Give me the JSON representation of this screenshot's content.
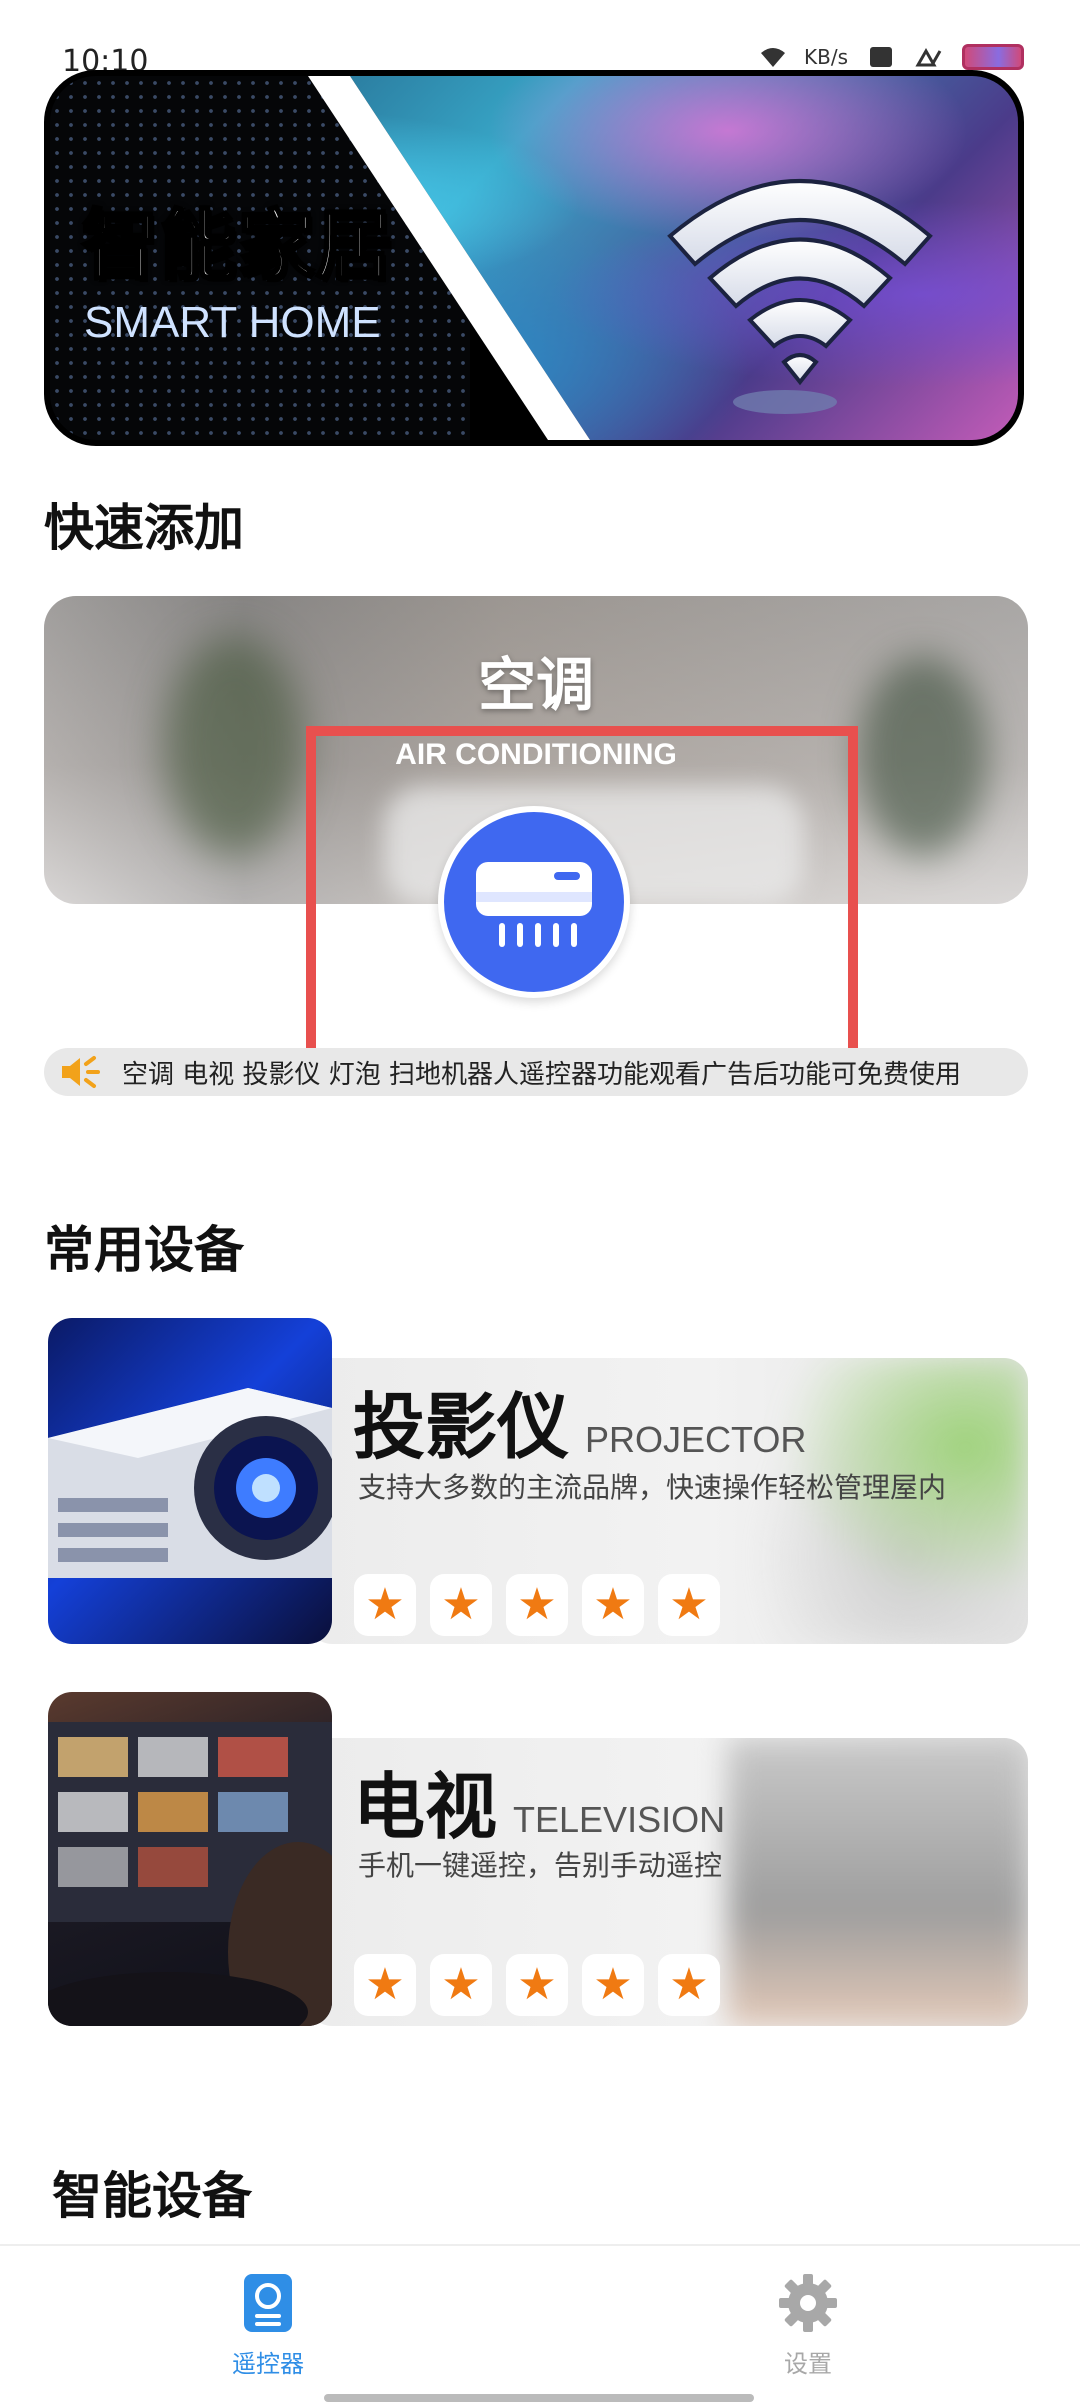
{
  "status_bar": {
    "time": "10:10",
    "speed": "KB/s"
  },
  "hero": {
    "title_cn": "智能家居",
    "title_en": "SMART HOME"
  },
  "quick_add": {
    "section_title": "快速添加",
    "card": {
      "title_cn": "空调",
      "title_en": "AIR CONDITIONING",
      "icon": "air-conditioner-icon"
    }
  },
  "notice": {
    "icon": "speaker-icon",
    "text": "空调 电视 投影仪 灯泡 扫地机器人遥控器功能观看广告后功能可免费使用"
  },
  "common_devices": {
    "section_title": "常用设备",
    "items": [
      {
        "title_cn": "投影仪",
        "title_en": "PROJECTOR",
        "description": "支持大多数的主流品牌，快速操作轻松管理屋内",
        "rating": 5,
        "star_icon": "star-icon"
      },
      {
        "title_cn": "电视",
        "title_en": "TELEVISION",
        "description": "手机一键遥控，告别手动遥控",
        "rating": 5,
        "star_icon": "star-icon"
      }
    ]
  },
  "smart_devices": {
    "section_title": "智能设备"
  },
  "tab_bar": {
    "tabs": [
      {
        "label": "遥控器",
        "icon": "remote-icon",
        "active": true,
        "color": "#2f8ee6"
      },
      {
        "label": "设置",
        "icon": "gear-icon",
        "active": false,
        "color": "#a8a8a8"
      }
    ]
  },
  "colors": {
    "accent": "#4a6df2",
    "highlight_box": "#e8504e",
    "star": "#f07a12"
  }
}
